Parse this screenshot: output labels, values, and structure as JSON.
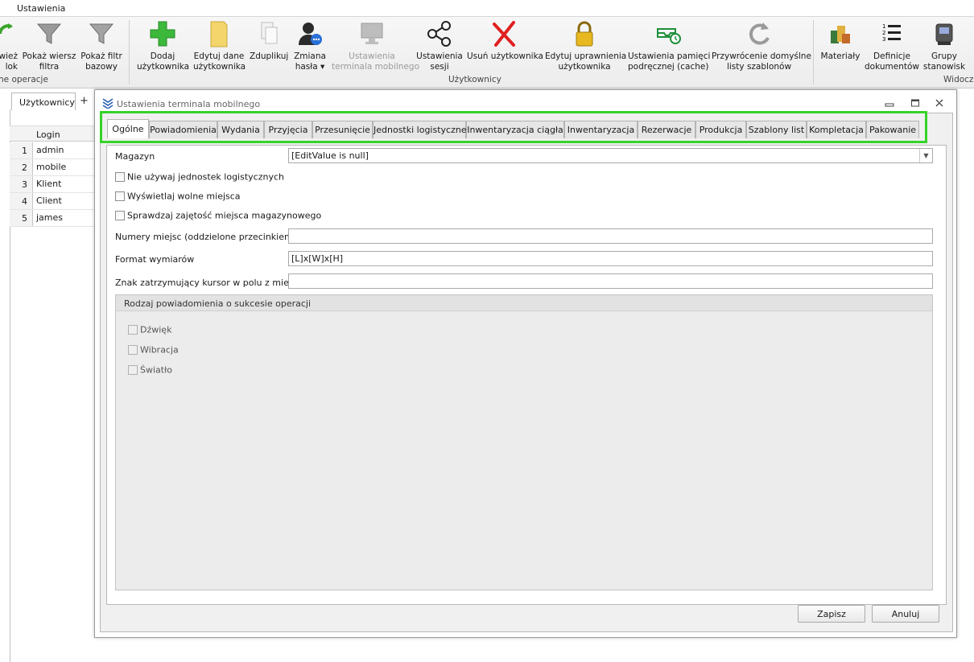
{
  "app": {
    "menu_title": "Ustawienia"
  },
  "ribbon": {
    "partial_left_label1": "wież\nlok",
    "buttons": [
      {
        "label": "Pokaż wiersz\nfiltra",
        "icon": "funnel-icon"
      },
      {
        "label": "Pokaż filtr\nbazowy",
        "icon": "funnel-icon"
      },
      {
        "label": "Dodaj\nużytkownika",
        "icon": "plus-icon"
      },
      {
        "label": "Edytuj dane\nużytkownika",
        "icon": "folder-icon"
      },
      {
        "label": "Zduplikuj",
        "icon": "duplicate-icon"
      },
      {
        "label": "Zmiana\nhasła ▾",
        "icon": "user-password-icon"
      },
      {
        "label": "Ustawienia\nterminala mobilnego",
        "icon": "monitor-icon",
        "disabled": true
      },
      {
        "label": "Ustawienia\nsesji",
        "icon": "share-icon"
      },
      {
        "label": "Usuń użytkownika",
        "icon": "delete-x-icon"
      },
      {
        "label": "Edytuj uprawnienia\nużytkownika",
        "icon": "lock-icon"
      },
      {
        "label": "Ustawienia pamięci\npodręcznej (cache)",
        "icon": "cache-tray-icon"
      },
      {
        "label": "Przywrócenie domyślne\nlisty szablonów",
        "icon": "refresh-icon"
      },
      {
        "label": "Materiały",
        "icon": "materials-icon"
      },
      {
        "label": "Definicje\ndokumentów",
        "icon": "numbered-list-icon"
      },
      {
        "label": "Grupy\nstanowisk",
        "icon": "workstation-group-icon"
      }
    ],
    "group_labels": {
      "left_partial": "ne operacje",
      "users": "Użytkownicy",
      "right_partial": "Widoczn"
    }
  },
  "background": {
    "tab_label": "Użytkownicy",
    "tab_add": "+",
    "grid_header": "Login",
    "rows": [
      {
        "num": "1",
        "login": "admin"
      },
      {
        "num": "2",
        "login": "mobile"
      },
      {
        "num": "3",
        "login": "Klient"
      },
      {
        "num": "4",
        "login": "Client"
      },
      {
        "num": "5",
        "login": "james"
      }
    ]
  },
  "dialog": {
    "title": "Ustawienia terminala mobilnego",
    "tabs": [
      "Ogólne",
      "Powiadomienia",
      "Wydania",
      "Przyjęcia",
      "Przesunięcie",
      "Jednostki logistyczne",
      "Inwentaryzacja ciągła",
      "Inwentaryzacja",
      "Rezerwacje",
      "Produkcja",
      "Szablony list",
      "Kompletacja",
      "Pakowanie"
    ],
    "active_tab": "Ogólne",
    "form": {
      "magazyn_label": "Magazyn",
      "magazyn_value": "[EditValue is null]",
      "chk_no_units": "Nie używaj jednostek logistycznych",
      "chk_free_places": "Wyświetlaj wolne miejsca",
      "chk_check_occupancy": "Sprawdzaj zajętość miejsca magazynowego",
      "places_label": "Numery miejsc (oddzielone przecinkiem)",
      "places_value": "",
      "dims_label": "Format wymiarów",
      "dims_value": "[L]x[W]x[H]",
      "stop_char_label": "Znak zatrzymujący kursor w polu z miejscem",
      "stop_char_value": ""
    },
    "notify_group": {
      "title": "Rodzaj powiadomienia o sukcesie operacji",
      "sound": "Dźwięk",
      "vibration": "Wibracja",
      "light": "Światło"
    },
    "buttons": {
      "save": "Zapisz",
      "cancel": "Anuluj"
    }
  },
  "colors": {
    "highlight_box": "#37d22a"
  }
}
